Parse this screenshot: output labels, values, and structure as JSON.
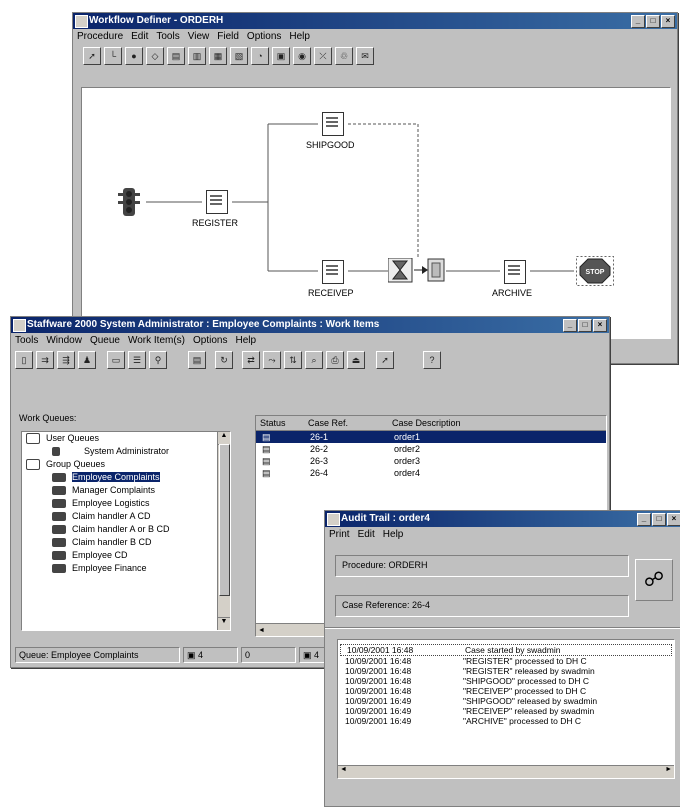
{
  "workflow": {
    "title": "Workflow Definer - ORDERH",
    "menu": [
      "Procedure",
      "Edit",
      "Tools",
      "View",
      "Field",
      "Options",
      "Help"
    ],
    "nodes": {
      "register": "REGISTER",
      "shipgood": "SHIPGOOD",
      "receivep": "RECEIVEP",
      "archive": "ARCHIVE",
      "stop": "STOP"
    }
  },
  "admin": {
    "title": "Staffware 2000 System Administrator : Employee Complaints : Work Items",
    "menu": [
      "Tools",
      "Window",
      "Queue",
      "Work Item(s)",
      "Options",
      "Help"
    ],
    "work_queues_label": "Work Queues:",
    "tree": {
      "user_queues": "User Queues",
      "system_admin": "System Administrator",
      "group_queues": "Group Queues",
      "groups": [
        "Employee Complaints",
        "Manager Complaints",
        "Employee Logistics",
        "Claim handler A CD",
        "Claim handler A or B CD",
        "Claim handler B CD",
        "Employee CD",
        "Employee Finance"
      ]
    },
    "grid": {
      "headers": [
        "Status",
        "Case Ref.",
        "Case Description"
      ],
      "rows": [
        {
          "ref": "26-1",
          "desc": "order1"
        },
        {
          "ref": "26-2",
          "desc": "order2"
        },
        {
          "ref": "26-3",
          "desc": "order3"
        },
        {
          "ref": "26-4",
          "desc": "order4"
        }
      ]
    },
    "status": {
      "queue": "Queue: Employee Complaints",
      "count1": "4",
      "count2": "0",
      "count3": "4"
    }
  },
  "audit": {
    "title": "Audit Trail : order4",
    "menu": [
      "Print",
      "Edit",
      "Help"
    ],
    "procedure": "Procedure:  ORDERH",
    "case_reference": "Case Reference:  26-4",
    "log": [
      {
        "time": "10/09/2001 16:48",
        "event": "Case started by swadmin"
      },
      {
        "time": "10/09/2001 16:48",
        "event": "\"REGISTER\" processed to DH C"
      },
      {
        "time": "10/09/2001 16:48",
        "event": "\"REGISTER\" released by swadmin"
      },
      {
        "time": "10/09/2001 16:48",
        "event": "\"SHIPGOOD\" processed to DH C"
      },
      {
        "time": "10/09/2001 16:48",
        "event": "\"RECEIVEP\" processed to DH C"
      },
      {
        "time": "10/09/2001 16:49",
        "event": "\"SHIPGOOD\" released by swadmin"
      },
      {
        "time": "10/09/2001 16:49",
        "event": "\"RECEIVEP\" released by swadmin"
      },
      {
        "time": "10/09/2001 16:49",
        "event": "\"ARCHIVE\" processed to DH C"
      }
    ]
  }
}
